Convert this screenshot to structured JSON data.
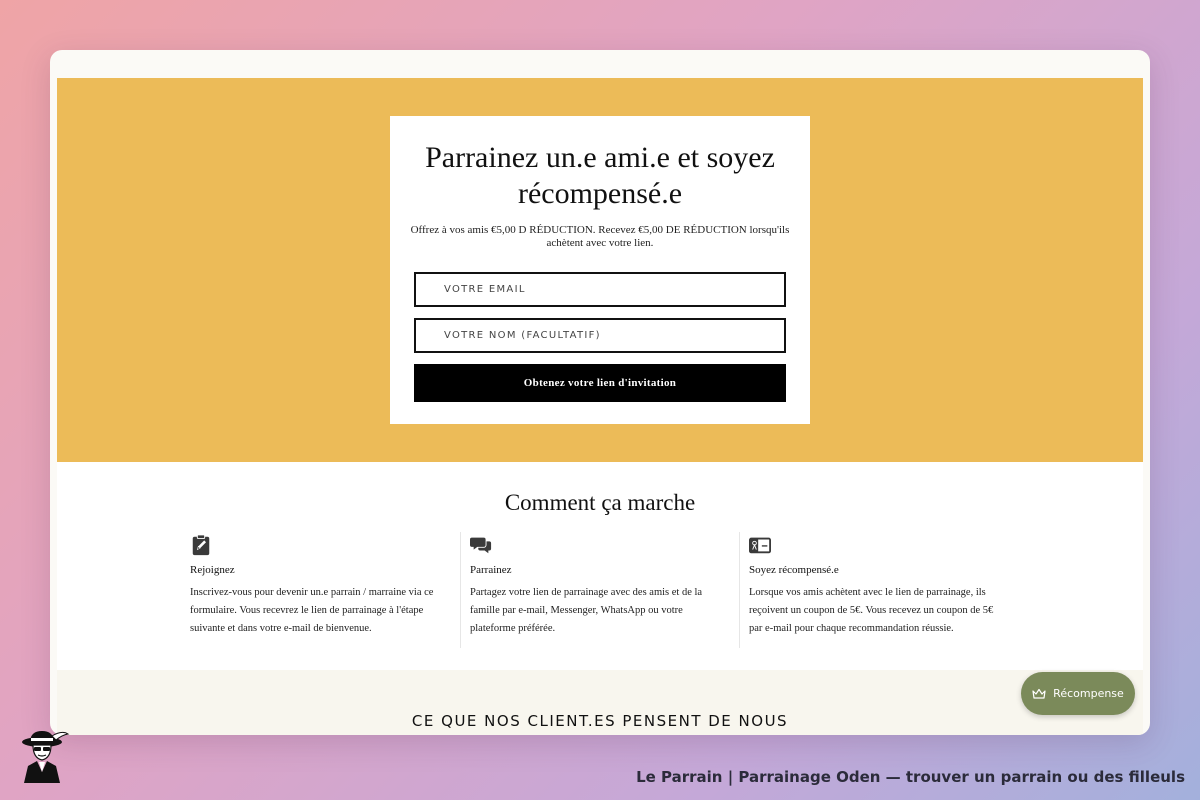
{
  "hero": {
    "title": "Parrainez un.e ami.e et soyez récompensé.e",
    "subtitle": "Offrez à vos amis €5,00 D RÉDUCTION. Recevez €5,00 DE RÉDUCTION lorsqu'ils achètent avec votre lien.",
    "email_placeholder": "VOTRE EMAIL",
    "name_placeholder": "VOTRE NOM (FACULTATIF)",
    "cta_label": "Obtenez votre lien d'invitation"
  },
  "how": {
    "title": "Comment ça marche",
    "steps": [
      {
        "icon": "clipboard-edit-icon",
        "title": "Rejoignez",
        "text": "Inscrivez-vous pour devenir un.e parrain / marraine via ce formulaire. Vous recevrez le lien de parrainage à l'étape suivante et dans votre e-mail de bienvenue."
      },
      {
        "icon": "chat-bubbles-icon",
        "title": "Parrainez",
        "text": "Partagez votre lien de parrainage avec des amis et de la famille par e-mail, Messenger, WhatsApp ou votre plateforme préférée."
      },
      {
        "icon": "gift-card-icon",
        "title": "Soyez récompensé.e",
        "text": "Lorsque vos amis achètent avec le lien de parrainage, ils reçoivent un coupon de 5€. Vous recevez un coupon de 5€ par e-mail pour chaque recommandation réussie."
      }
    ]
  },
  "testimonials": {
    "title": "CE QUE NOS CLIENT.ES PENSENT DE NOUS"
  },
  "reward_button": {
    "label": "Récompense",
    "icon": "crown-icon"
  },
  "caption": "Le Parrain | Parrainage Oden — trouver un parrain ou des filleuls",
  "colors": {
    "hero_bg": "#ecbb58",
    "cta_bg": "#000000",
    "reward_bg": "#7b8a5a"
  }
}
